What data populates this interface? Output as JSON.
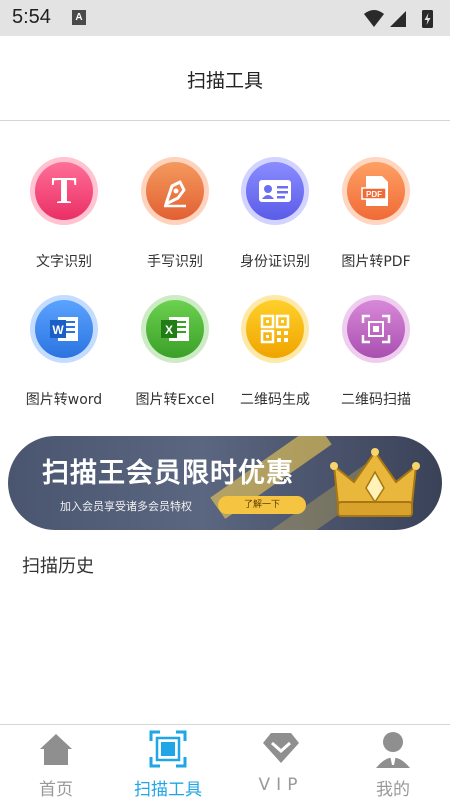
{
  "status_bar": {
    "time": "5:54",
    "notification_icon": "A"
  },
  "header": {
    "title": "扫描工具"
  },
  "tools": [
    {
      "label": "文字识别",
      "icon": "text-icon",
      "color": "#f2477a"
    },
    {
      "label": "手写识别",
      "icon": "pen-icon",
      "color": "#ee7d4a"
    },
    {
      "label": "身份证识别",
      "icon": "id-card-icon",
      "color": "#6c6ef2"
    },
    {
      "label": "图片转PDF",
      "icon": "pdf-icon",
      "color": "#f58a4a"
    },
    {
      "label": "图片转word",
      "icon": "word-icon",
      "color": "#3d8ff2"
    },
    {
      "label": "图片转Excel",
      "icon": "excel-icon",
      "color": "#4fb83a"
    },
    {
      "label": "二维码生成",
      "icon": "qr-code-icon",
      "color": "#f6b500"
    },
    {
      "label": "二维码扫描",
      "icon": "qr-scan-icon",
      "color": "#c069c4"
    }
  ],
  "banner": {
    "headline": "扫描王会员限时优惠",
    "subtext": "加入会员享受诸多会员特权",
    "button_label": "了解一下"
  },
  "history": {
    "title": "扫描历史"
  },
  "tabbar": {
    "items": [
      {
        "label": "首页",
        "icon": "home-icon"
      },
      {
        "label": "扫描工具",
        "icon": "scan-icon"
      },
      {
        "label": "VIP",
        "icon": "vip-icon"
      },
      {
        "label": "我的",
        "icon": "profile-icon"
      }
    ],
    "active_index": 1,
    "active_color": "#1ea6e6",
    "inactive_color": "#999999"
  }
}
